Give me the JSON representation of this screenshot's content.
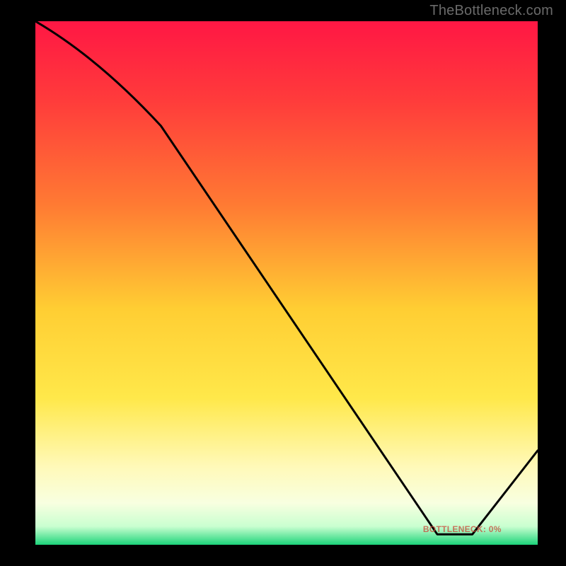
{
  "watermark": "TheBottleneck.com",
  "annotation_text": "BOTTLENECK: 0%",
  "chart_data": {
    "type": "line",
    "title": "",
    "xlabel": "",
    "ylabel": "",
    "xlim": [
      0,
      100
    ],
    "ylim": [
      0,
      100
    ],
    "grid": false,
    "x": [
      0,
      25,
      80,
      87,
      100
    ],
    "values": [
      100,
      80,
      2,
      2,
      18
    ],
    "optimal_range_x": [
      80,
      87
    ],
    "gradient_stops": [
      {
        "pos": 0.0,
        "color": "#ff1744"
      },
      {
        "pos": 0.15,
        "color": "#ff3b3b"
      },
      {
        "pos": 0.35,
        "color": "#ff7a33"
      },
      {
        "pos": 0.55,
        "color": "#ffce33"
      },
      {
        "pos": 0.72,
        "color": "#ffe84a"
      },
      {
        "pos": 0.85,
        "color": "#fff9b8"
      },
      {
        "pos": 0.92,
        "color": "#f8ffe0"
      },
      {
        "pos": 0.965,
        "color": "#c9ffd0"
      },
      {
        "pos": 1.0,
        "color": "#1cd47a"
      }
    ]
  }
}
